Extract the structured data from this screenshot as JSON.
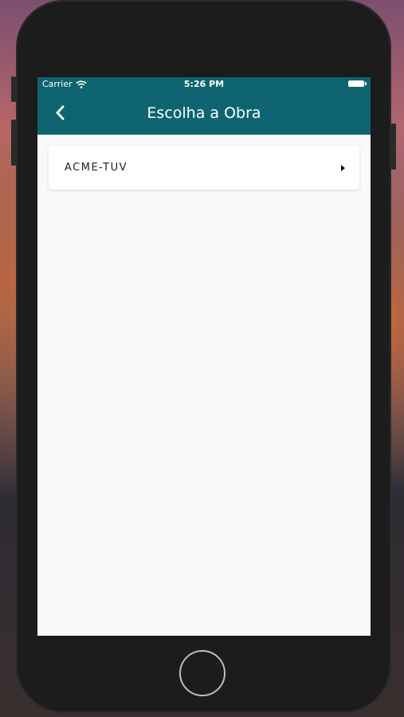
{
  "status_bar": {
    "carrier": "Carrier",
    "time": "5:26 PM"
  },
  "nav_bar": {
    "title": "Escolha a Obra",
    "back_icon": "chevron-left-icon"
  },
  "list": {
    "items": [
      {
        "label": "ACME-TUV",
        "icon": "chevron-right-icon"
      }
    ]
  },
  "colors": {
    "nav_background": "#0e6470",
    "screen_background": "#f9f9f9",
    "device_body": "#1c1c1c"
  }
}
